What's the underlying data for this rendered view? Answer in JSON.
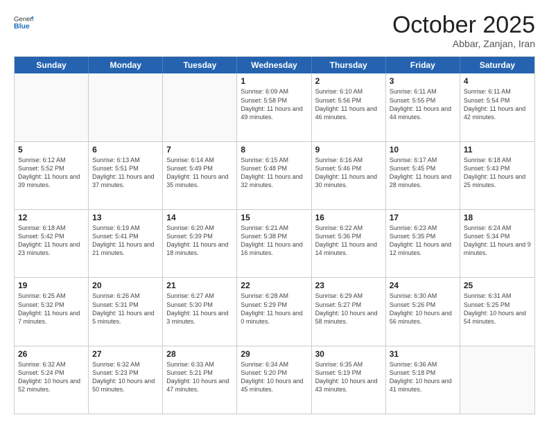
{
  "header": {
    "logo_general": "General",
    "logo_blue": "Blue",
    "month_title": "October 2025",
    "subtitle": "Abbar, Zanjan, Iran"
  },
  "weekdays": [
    "Sunday",
    "Monday",
    "Tuesday",
    "Wednesday",
    "Thursday",
    "Friday",
    "Saturday"
  ],
  "rows": [
    [
      {
        "day": "",
        "text": ""
      },
      {
        "day": "",
        "text": ""
      },
      {
        "day": "",
        "text": ""
      },
      {
        "day": "1",
        "text": "Sunrise: 6:09 AM\nSunset: 5:58 PM\nDaylight: 11 hours and 49 minutes."
      },
      {
        "day": "2",
        "text": "Sunrise: 6:10 AM\nSunset: 5:56 PM\nDaylight: 11 hours and 46 minutes."
      },
      {
        "day": "3",
        "text": "Sunrise: 6:11 AM\nSunset: 5:55 PM\nDaylight: 11 hours and 44 minutes."
      },
      {
        "day": "4",
        "text": "Sunrise: 6:11 AM\nSunset: 5:54 PM\nDaylight: 11 hours and 42 minutes."
      }
    ],
    [
      {
        "day": "5",
        "text": "Sunrise: 6:12 AM\nSunset: 5:52 PM\nDaylight: 11 hours and 39 minutes."
      },
      {
        "day": "6",
        "text": "Sunrise: 6:13 AM\nSunset: 5:51 PM\nDaylight: 11 hours and 37 minutes."
      },
      {
        "day": "7",
        "text": "Sunrise: 6:14 AM\nSunset: 5:49 PM\nDaylight: 11 hours and 35 minutes."
      },
      {
        "day": "8",
        "text": "Sunrise: 6:15 AM\nSunset: 5:48 PM\nDaylight: 11 hours and 32 minutes."
      },
      {
        "day": "9",
        "text": "Sunrise: 6:16 AM\nSunset: 5:46 PM\nDaylight: 11 hours and 30 minutes."
      },
      {
        "day": "10",
        "text": "Sunrise: 6:17 AM\nSunset: 5:45 PM\nDaylight: 11 hours and 28 minutes."
      },
      {
        "day": "11",
        "text": "Sunrise: 6:18 AM\nSunset: 5:43 PM\nDaylight: 11 hours and 25 minutes."
      }
    ],
    [
      {
        "day": "12",
        "text": "Sunrise: 6:18 AM\nSunset: 5:42 PM\nDaylight: 11 hours and 23 minutes."
      },
      {
        "day": "13",
        "text": "Sunrise: 6:19 AM\nSunset: 5:41 PM\nDaylight: 11 hours and 21 minutes."
      },
      {
        "day": "14",
        "text": "Sunrise: 6:20 AM\nSunset: 5:39 PM\nDaylight: 11 hours and 18 minutes."
      },
      {
        "day": "15",
        "text": "Sunrise: 6:21 AM\nSunset: 5:38 PM\nDaylight: 11 hours and 16 minutes."
      },
      {
        "day": "16",
        "text": "Sunrise: 6:22 AM\nSunset: 5:36 PM\nDaylight: 11 hours and 14 minutes."
      },
      {
        "day": "17",
        "text": "Sunrise: 6:23 AM\nSunset: 5:35 PM\nDaylight: 11 hours and 12 minutes."
      },
      {
        "day": "18",
        "text": "Sunrise: 6:24 AM\nSunset: 5:34 PM\nDaylight: 11 hours and 9 minutes."
      }
    ],
    [
      {
        "day": "19",
        "text": "Sunrise: 6:25 AM\nSunset: 5:32 PM\nDaylight: 11 hours and 7 minutes."
      },
      {
        "day": "20",
        "text": "Sunrise: 6:26 AM\nSunset: 5:31 PM\nDaylight: 11 hours and 5 minutes."
      },
      {
        "day": "21",
        "text": "Sunrise: 6:27 AM\nSunset: 5:30 PM\nDaylight: 11 hours and 3 minutes."
      },
      {
        "day": "22",
        "text": "Sunrise: 6:28 AM\nSunset: 5:29 PM\nDaylight: 11 hours and 0 minutes."
      },
      {
        "day": "23",
        "text": "Sunrise: 6:29 AM\nSunset: 5:27 PM\nDaylight: 10 hours and 58 minutes."
      },
      {
        "day": "24",
        "text": "Sunrise: 6:30 AM\nSunset: 5:26 PM\nDaylight: 10 hours and 56 minutes."
      },
      {
        "day": "25",
        "text": "Sunrise: 6:31 AM\nSunset: 5:25 PM\nDaylight: 10 hours and 54 minutes."
      }
    ],
    [
      {
        "day": "26",
        "text": "Sunrise: 6:32 AM\nSunset: 5:24 PM\nDaylight: 10 hours and 52 minutes."
      },
      {
        "day": "27",
        "text": "Sunrise: 6:32 AM\nSunset: 5:23 PM\nDaylight: 10 hours and 50 minutes."
      },
      {
        "day": "28",
        "text": "Sunrise: 6:33 AM\nSunset: 5:21 PM\nDaylight: 10 hours and 47 minutes."
      },
      {
        "day": "29",
        "text": "Sunrise: 6:34 AM\nSunset: 5:20 PM\nDaylight: 10 hours and 45 minutes."
      },
      {
        "day": "30",
        "text": "Sunrise: 6:35 AM\nSunset: 5:19 PM\nDaylight: 10 hours and 43 minutes."
      },
      {
        "day": "31",
        "text": "Sunrise: 6:36 AM\nSunset: 5:18 PM\nDaylight: 10 hours and 41 minutes."
      },
      {
        "day": "",
        "text": ""
      }
    ]
  ]
}
